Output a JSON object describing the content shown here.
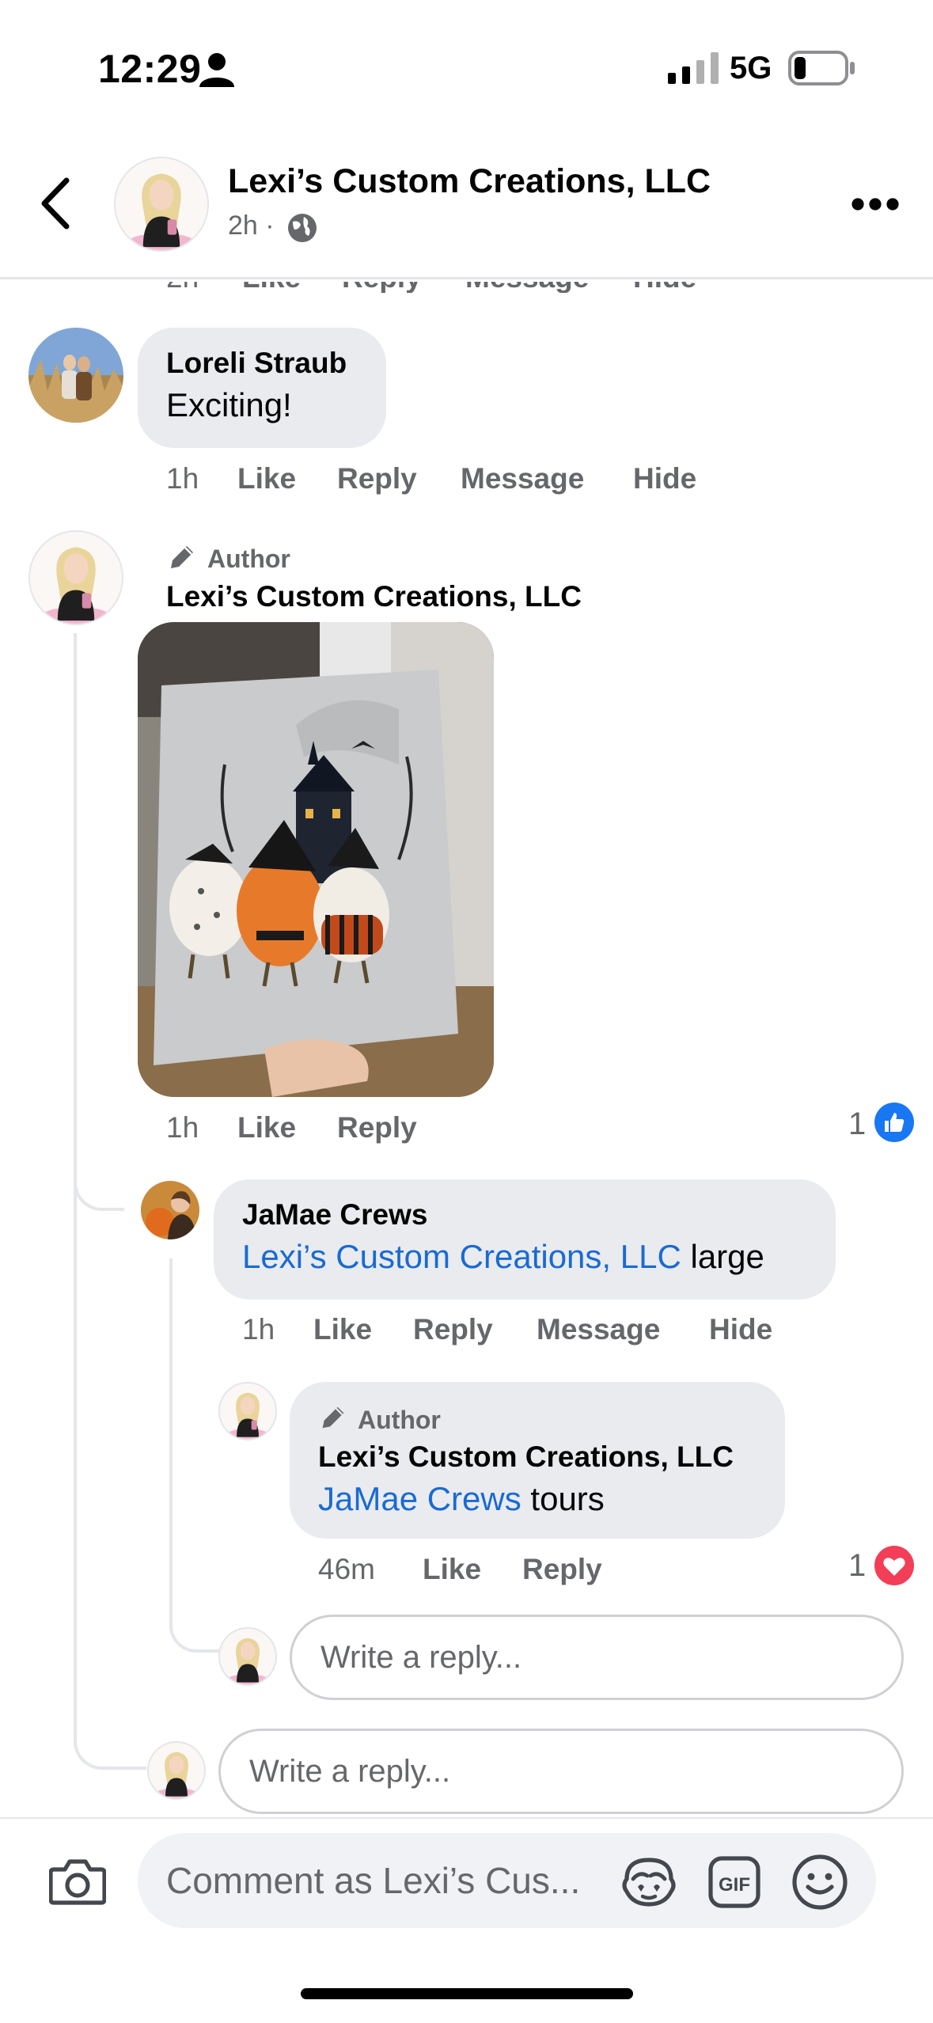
{
  "status_bar": {
    "time": "12:29",
    "network": "5G"
  },
  "header": {
    "title": "Lexi’s Custom Creations, LLC",
    "subtitle": "2h ·"
  },
  "partial_row": {
    "time": "2h",
    "like": "Like",
    "reply": "Reply",
    "message": "Message",
    "hide": "Hide"
  },
  "comments": [
    {
      "author": "Loreli Straub",
      "text": "Exciting!",
      "time": "1h",
      "like": "Like",
      "reply": "Reply",
      "message": "Message",
      "hide": "Hide"
    },
    {
      "author_tag": "Author",
      "author": "Lexi’s Custom Creations, LLC",
      "time": "1h",
      "like": "Like",
      "reply": "Reply",
      "reaction_count": "1",
      "reaction": "like",
      "replies": [
        {
          "author": "JaMae Crews",
          "mention": "Lexi’s Custom Creations, LLC",
          "text": " large",
          "time": "1h",
          "like": "Like",
          "reply": "Reply",
          "message": "Message",
          "hide": "Hide",
          "replies": [
            {
              "author_tag": "Author",
              "author": "Lexi’s Custom Creations, LLC",
              "mention": "JaMae Crews",
              "text": " tours",
              "time": "46m",
              "like": "Like",
              "reply": "Reply",
              "reaction_count": "1",
              "reaction": "love"
            }
          ]
        }
      ]
    }
  ],
  "reply_placeholder": "Write a reply...",
  "comment_placeholder": "Comment as Lexi’s Cus...",
  "colors": {
    "link": "#1a6ad2",
    "like": "#1877f2",
    "love": "#f33e58",
    "bubble": "#e9ebee",
    "meta": "#65676b"
  }
}
